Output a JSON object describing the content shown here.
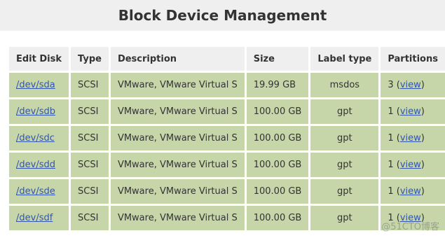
{
  "page": {
    "title": "Block Device Management"
  },
  "table": {
    "headers": {
      "edit_disk": "Edit Disk",
      "type": "Type",
      "description": "Description",
      "size": "Size",
      "label_type": "Label type",
      "partitions": "Partitions"
    },
    "rows": [
      {
        "disk": "/dev/sda",
        "type": "SCSI",
        "description": "VMware, VMware Virtual S",
        "size": "19.99 GB",
        "label_type": "msdos",
        "partitions_count": "3",
        "view_label": "view"
      },
      {
        "disk": "/dev/sdb",
        "type": "SCSI",
        "description": "VMware, VMware Virtual S",
        "size": "100.00 GB",
        "label_type": "gpt",
        "partitions_count": "1",
        "view_label": "view"
      },
      {
        "disk": "/dev/sdc",
        "type": "SCSI",
        "description": "VMware, VMware Virtual S",
        "size": "100.00 GB",
        "label_type": "gpt",
        "partitions_count": "1",
        "view_label": "view"
      },
      {
        "disk": "/dev/sdd",
        "type": "SCSI",
        "description": "VMware, VMware Virtual S",
        "size": "100.00 GB",
        "label_type": "gpt",
        "partitions_count": "1",
        "view_label": "view"
      },
      {
        "disk": "/dev/sde",
        "type": "SCSI",
        "description": "VMware, VMware Virtual S",
        "size": "100.00 GB",
        "label_type": "gpt",
        "partitions_count": "1",
        "view_label": "view"
      },
      {
        "disk": "/dev/sdf",
        "type": "SCSI",
        "description": "VMware, VMware Virtual S",
        "size": "100.00 GB",
        "label_type": "gpt",
        "partitions_count": "1",
        "view_label": "view"
      }
    ]
  },
  "watermark": "@51CTO博客",
  "colors": {
    "header_bg": "#efefef",
    "row_bg": "#c6d6a8",
    "link": "#3355aa"
  }
}
